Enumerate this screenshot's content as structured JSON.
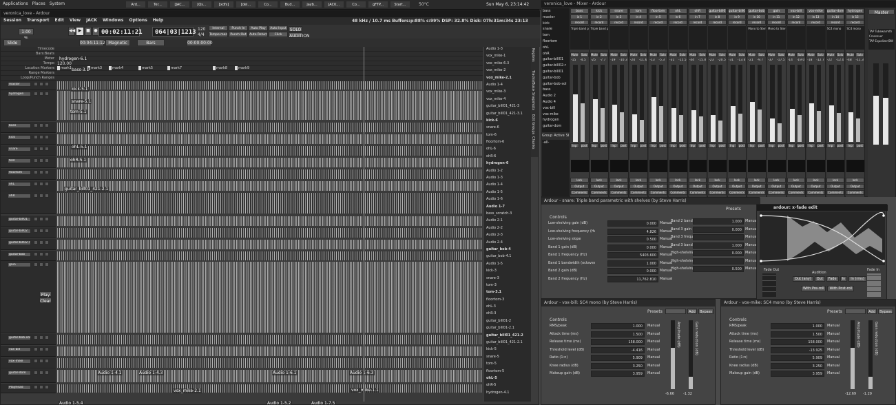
{
  "top": {
    "menus": [
      "Applications",
      "Places",
      "System"
    ],
    "tasks": [
      "Ard...",
      "Ter...",
      "[JAC...",
      "[Qs...",
      "[xdfs]",
      "[del...",
      "Co...",
      "Bud...",
      "jayb...",
      "JACK...",
      "Co...",
      "gFTP...",
      "Start..."
    ],
    "clock": "Sun May 6, 23:14:42",
    "temp": "50°C"
  },
  "editor": {
    "title": "veronica_love - Ardour",
    "menus": [
      "Session",
      "Transport",
      "Edit",
      "View",
      "JACK",
      "Windows",
      "Options",
      "Help"
    ],
    "status": "48 kHz / 10.7 ms  Buffers:p:88% c:99%  DSP: 32.8%  Disk: 07h:31m:34s 23:13",
    "clock": "00:02:11:21",
    "bbt": "064|03|1213",
    "bpm": "120",
    "bpm2": "4/4",
    "transport_btns": [
      "Internal",
      "Punch In",
      "Auto Play",
      "Auto Input",
      "Tempo master",
      "Punch Out",
      "Auto Return",
      "Click"
    ],
    "solo": "SOLO",
    "audition": "AUDITION",
    "edit_mode": "Slide Edit",
    "snap": "Magnetic",
    "snap2": "Bars",
    "nudge": "00:04:11:12",
    "nudge2": "00:00:00:00",
    "zoom": "1:00 %",
    "rulers": [
      "Timecode",
      "Bars:Beats",
      "Meter",
      "Tempo",
      "Location Markers",
      "Range Markers",
      "Loop/Punch Ranges"
    ],
    "markers": [
      "mark1",
      "mark3",
      "mark4",
      "mark5",
      "mark7",
      "mark8",
      "mark9"
    ],
    "tempo_val": "120.00",
    "tracks": [
      {
        "n": "master"
      },
      {
        "n": "hydrogen"
      },
      {
        "n": "bass"
      },
      {
        "n": "kick"
      },
      {
        "n": "snare"
      },
      {
        "n": "tom"
      },
      {
        "n": "floortom"
      },
      {
        "n": "ohL"
      },
      {
        "n": "ohR"
      },
      {
        "n": "guitar-bill01"
      },
      {
        "n": "guitar-bill02"
      },
      {
        "n": "guitar-bill02-r"
      },
      {
        "n": "guitar-bob"
      },
      {
        "n": "gain"
      },
      {
        "n": "guitar-bob-sol"
      },
      {
        "n": "vox-bill"
      },
      {
        "n": "vox-mike"
      },
      {
        "n": "guitar-dom"
      },
      {
        "n": "Playhead"
      }
    ],
    "regions": [
      "hydrogen-6.1",
      "bass-3.1",
      "kick-5.1",
      "snare-5.1",
      "tom-5.1",
      "ohL-5.1",
      "ohR-5.1",
      "guitar_bill01_421-2.1",
      "Audio 1-4.1",
      "Audio 1-4.3",
      "Audio 1-6.1",
      "Audio 1-6.3",
      "vox_mike-2.1",
      "vox_mike-1.1",
      "Audio 1-5.4",
      "Audio 1-5.2",
      "Audio 1-7.5"
    ],
    "play": "Play",
    "clear": "Clear",
    "regionlist": [
      "Audio 1-3",
      "vox_mike-1",
      "vox_mike-6.3",
      "vox_mike-2",
      "vox_mike-2.1",
      "Audio 1-4",
      "vox_mike-3",
      "vox_mike-4",
      "guitar_bill01_421-3",
      "guitar_bill01_421-3.1",
      "kick-6",
      "snare-6",
      "tom-6",
      "floortom-6",
      "ohL-6",
      "ohR-6",
      "hydrogen-6",
      "Audio 1-2",
      "Audio 1-3",
      "Audio 1-4",
      "Audio 1-5",
      "Audio 1-6",
      "Audio 1-7",
      "bass_scratch-3",
      "Audio 2-1",
      "Audio 2-2",
      "Audio 2-3",
      "Audio 2-4",
      "guitar_bob-4",
      "guitar_bob-4.1",
      "Audio 1-5",
      "kick-3",
      "snare-3",
      "tom-3",
      "tom-3.1",
      "floortom-3",
      "ohL-3",
      "ohR-3",
      "guitar_bill01-2",
      "guitar_bill01-2.1",
      "guitar_bill01_421-2",
      "guitar_bill01_421-2.1",
      "kick-5",
      "snare-5",
      "tom-5",
      "floortom-5",
      "ohL-5",
      "ohR-5",
      "hydrogen-4.1"
    ],
    "sidetabs": [
      "Regions",
      "Tracks/Busses",
      "Snapshots",
      "Edit Groups",
      "Chunks"
    ]
  },
  "mixer": {
    "title": "veronica_love - Mixer - Ardour",
    "strips": [
      "bass",
      "kick",
      "snare",
      "tom",
      "floortom",
      "ohL",
      "ohR",
      "guitar-bill01",
      "guitar-bill02",
      "guitar-bob",
      "gain",
      "vox-bill",
      "vox-mike",
      "guitar-dom",
      "hydrogen"
    ],
    "plugins": [
      "Triple band par",
      "Triple band par",
      "",
      "",
      "",
      "",
      "",
      "",
      "",
      "Mono to Stereo",
      "Mono to Stereo",
      "",
      "",
      "SC4 mono",
      "SC4 mono"
    ],
    "strip_labels": [
      "bass",
      "kick",
      "snare",
      "tom",
      "floortom",
      "ohL",
      "ohR",
      "guitar-bill01",
      "guitar-bill02",
      "guitar-bob",
      "gain",
      "vox-bill",
      "vox-mike",
      "guitar-dom",
      "hydr"
    ],
    "levels": [
      "-15",
      "-25",
      "-19",
      "-24",
      "-13",
      "-31",
      "-44",
      "-23",
      "-31",
      "-21",
      "-37",
      "-14",
      "-18",
      "-22",
      "-48"
    ],
    "peak": [
      "-4.5",
      "-7.7",
      "-10.3",
      "-11.6",
      "-5.3",
      "-15.5",
      "-15.0",
      "-20.5",
      "-13.6",
      "-9.7",
      "-17.5",
      "-19.0",
      "-12.7",
      "-12.0",
      "-11.3"
    ],
    "fader_fill": [
      0.62,
      0.55,
      0.48,
      0.36,
      0.58,
      0.44,
      0.41,
      0.35,
      0.46,
      0.52,
      0.3,
      0.43,
      0.5,
      0.47,
      0.38
    ],
    "modes": [
      "Mute",
      "Solo"
    ],
    "inputs": [
      "in 1",
      "in 2",
      "in 3",
      "in 4",
      "in 5",
      "in 6",
      "in 7",
      "in 8",
      "in 9",
      "in 10",
      "in 11",
      "in 12",
      "in 13",
      "in 14",
      "in 15"
    ],
    "output": "Output",
    "comments": "Comments",
    "iso": "Inp",
    "post": "post",
    "lock": "lock",
    "record": "record",
    "grouptab": [
      "Group",
      "Active",
      "SI"
    ],
    "group_all": "-all-",
    "master": {
      "name": "Master",
      "strip_list": [
        "TAP Tubewarmth",
        "Crossover",
        "TAP Equalizer/BW"
      ]
    },
    "tracklist": [
      "bass",
      "master",
      "kick",
      "snare",
      "tom",
      "floortom",
      "ohL",
      "ohR",
      "guitar-bill01",
      "guitar-bill02-r",
      "guitar-bill01",
      "guitar-bob",
      "guitar-bob-sol",
      "bass",
      "Audio 2",
      "Audio 4",
      "vox-bill",
      "vox-mike",
      "hydrogen",
      "guitar-dom"
    ]
  },
  "eq": {
    "title": "Ardour - snare: Triple band parametric with shelves (by Steve Harris)",
    "presets": "Presets",
    "controls": "Controls",
    "left": [
      {
        "l": "Low-shelving gain (dB)",
        "v": "0.000"
      },
      {
        "l": "Low-shelving frequency (Hz)",
        "v": "4,826"
      },
      {
        "l": "Low-shelving slope",
        "v": "0.500"
      },
      {
        "l": "Band 1 gain (dB)",
        "v": "0.000"
      },
      {
        "l": "Band 1 frequency (Hz)",
        "v": "5403.600"
      },
      {
        "l": "Band 1 bandwidth (octaves)",
        "v": "1.000"
      },
      {
        "l": "Band 2 gain (dB)",
        "v": "0.000"
      },
      {
        "l": "Band 2 frequency (Hz)",
        "v": "11,762.810"
      }
    ],
    "right": [
      {
        "l": "Band 2 bandwidth (octaves)",
        "v": "1.000"
      },
      {
        "l": "Band 3 gain (dB)",
        "v": "0.000"
      },
      {
        "l": "Band 3 frequency (Hz)",
        "v": ""
      },
      {
        "l": "Band 3 bandwidth (octaves)",
        "v": "1.000"
      },
      {
        "l": "High-shelving gain (dB)",
        "v": "0.000"
      },
      {
        "l": "High-shelving frequency (Hz)",
        "v": ""
      },
      {
        "l": "High-shelving slope",
        "v": "0.500"
      }
    ],
    "manual": "Manual"
  },
  "xfade": {
    "title": "ardour: x-fade edit",
    "fadeout": "Fade Out",
    "fadein": "Fade In",
    "audition": "Audition",
    "btns": [
      "Out (any)",
      "Out",
      "Fade",
      "In",
      "In (rms)"
    ],
    "btns2": [
      "With Pre-roll",
      "With Post-roll"
    ],
    "actions": [
      "Clear",
      "Reset",
      "Cancel",
      "OK"
    ]
  },
  "sc4a": {
    "title": "Ardour - vox-bill: SC4 mono (by Steve Harris)",
    "presets": "Presets",
    "add": "Add",
    "bypass": "Bypass",
    "controls": "Controls",
    "rows": [
      {
        "l": "RMS/peak",
        "v": "1.000"
      },
      {
        "l": "Attack time (ms)",
        "v": "1.500"
      },
      {
        "l": "Release time (ms)",
        "v": "158.000"
      },
      {
        "l": "Threshold level (dB)",
        "v": "-4.416"
      },
      {
        "l": "Ratio (1:n)",
        "v": "5.909"
      },
      {
        "l": "Knee radius (dB)",
        "v": "3.250"
      },
      {
        "l": "Makeup gain (dB)",
        "v": "3.959"
      }
    ],
    "meters": [
      "Amplitude (dB)",
      "Gain reduction (dB)"
    ],
    "mvals": [
      "-6.66",
      "-1.32"
    ],
    "manual": "Manual"
  },
  "sc4b": {
    "title": "Ardour - vox-mike: SC4 mono (by Steve Harris)",
    "presets": "Presets",
    "add": "Add",
    "bypass": "Bypass",
    "controls": "Controls",
    "rows": [
      {
        "l": "RMS/peak",
        "v": "1.000"
      },
      {
        "l": "Attack time (ms)",
        "v": "1.500"
      },
      {
        "l": "Release time (ms)",
        "v": "158.000"
      },
      {
        "l": "Threshold level (dB)",
        "v": "-13.925"
      },
      {
        "l": "Ratio (1:n)",
        "v": "5.909"
      },
      {
        "l": "Knee radius (dB)",
        "v": "3.250"
      },
      {
        "l": "Makeup gain (dB)",
        "v": "3.959"
      }
    ],
    "meters": [
      "Amplitude (dB)",
      "Gain reduction (dB)"
    ],
    "mvals": [
      "-12.69",
      "-1.29"
    ],
    "manual": "Manual"
  }
}
